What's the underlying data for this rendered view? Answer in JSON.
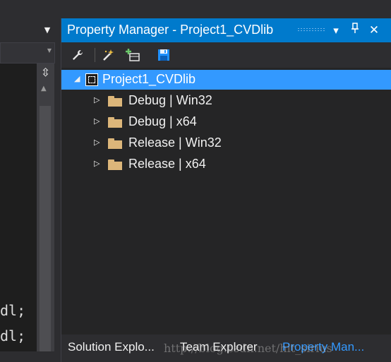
{
  "editor": {
    "code_lines": [
      "dl;",
      "dl;"
    ]
  },
  "panel": {
    "title": "Property Manager - Project1_CVDlib",
    "accent_color": "#007acc",
    "selected_color": "#3399ff",
    "titlebar_buttons": {
      "dropdown": "▾",
      "pin": "ᛘ",
      "close": "✕"
    },
    "toolbar": [
      {
        "icon": "wrench-icon"
      },
      {
        "icon": "wand-icon"
      },
      {
        "icon": "add-sheet-icon"
      },
      {
        "icon": "save-icon"
      }
    ]
  },
  "tree": {
    "root": {
      "label": "Project1_CVDlib",
      "expanded": true,
      "selected": true
    },
    "children": [
      {
        "label": "Debug | Win32"
      },
      {
        "label": "Debug | x64"
      },
      {
        "label": "Release | Win32"
      },
      {
        "label": "Release | x64"
      }
    ]
  },
  "tabs": [
    {
      "label": "Solution Explo...",
      "active": false
    },
    {
      "label": "Team Explorer",
      "active": false
    },
    {
      "label": "Property Man...",
      "active": true
    }
  ],
  "watermark": "http://blog.csdn.net/hit_sirius"
}
